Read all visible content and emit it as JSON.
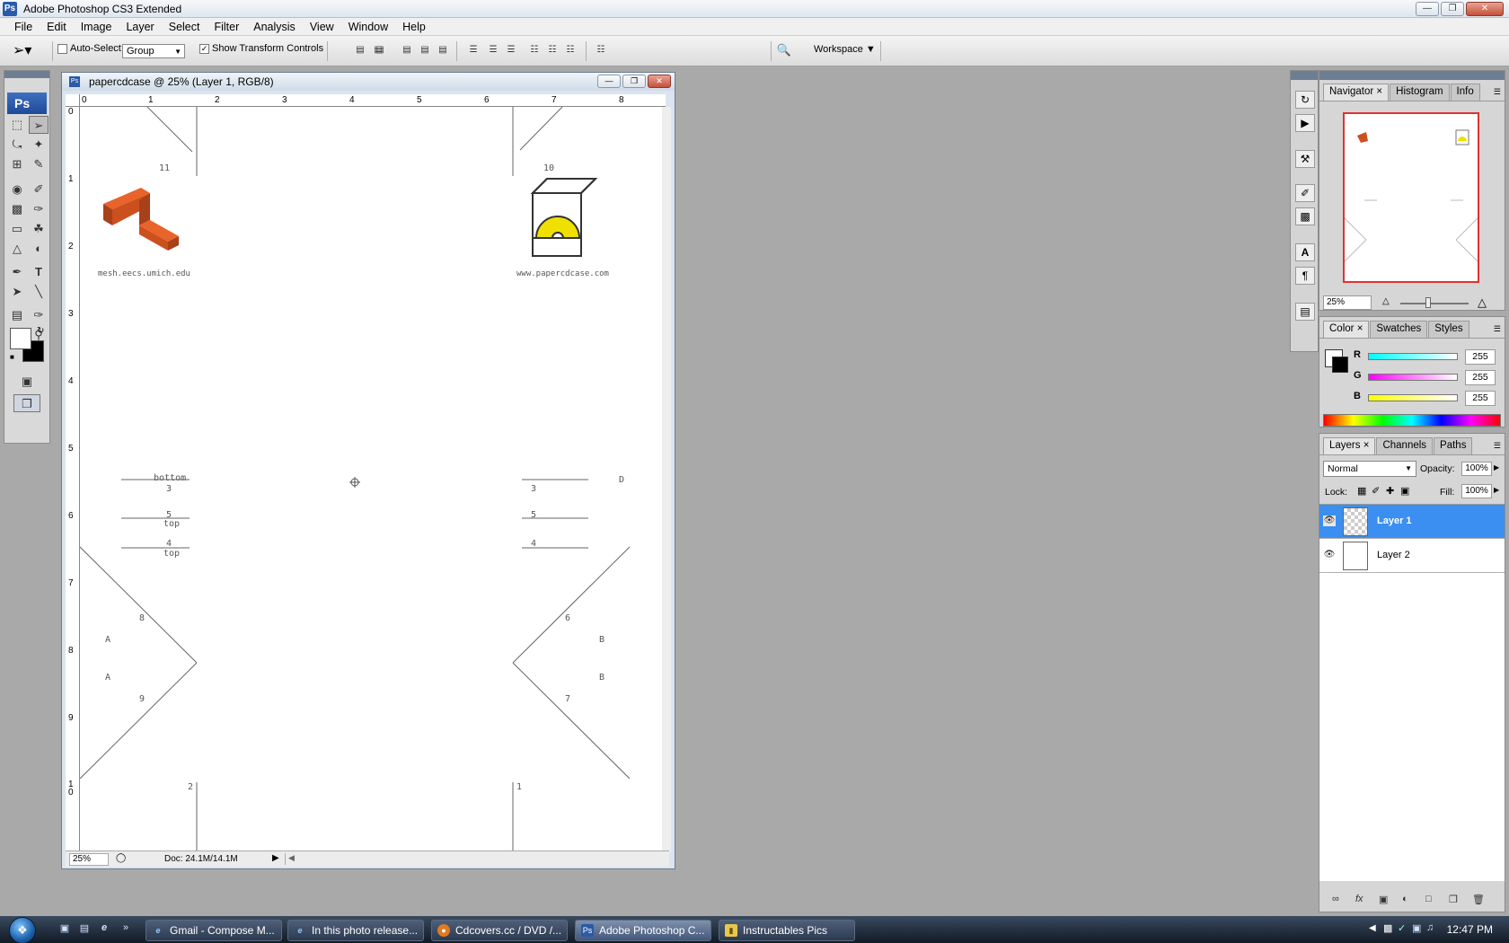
{
  "app": {
    "title": "Adobe Photoshop CS3 Extended",
    "icon": "Ps",
    "window_controls": [
      "minimize",
      "maximize",
      "close"
    ]
  },
  "menu": [
    "File",
    "Edit",
    "Image",
    "Layer",
    "Select",
    "Filter",
    "Analysis",
    "View",
    "Window",
    "Help"
  ],
  "options": {
    "auto_select_label": "Auto-Select:",
    "auto_select_value": "Group",
    "auto_select_checked": false,
    "show_transform_label": "Show Transform Controls",
    "show_transform_checked": true,
    "workspace_label": "Workspace"
  },
  "toolbox": {
    "logo": "Ps",
    "tools": [
      "move",
      "marquee",
      "lasso",
      "magic-wand",
      "crop",
      "slice",
      "healing",
      "brush",
      "stamp",
      "history-brush",
      "eraser",
      "paint-bucket",
      "blur",
      "dodge",
      "pen",
      "type",
      "path-selection",
      "line",
      "notes",
      "eyedropper",
      "hand",
      "zoom"
    ],
    "foreground": "#ffffff",
    "background": "#000000"
  },
  "document": {
    "title": "papercdcase @ 25% (Layer 1, RGB/8)",
    "zoom": "25%",
    "doc_info": "Doc: 24.1M/14.1M",
    "ruler_h": [
      "0",
      "1",
      "2",
      "3",
      "4",
      "5",
      "6",
      "7",
      "8"
    ],
    "ruler_v": [
      "0",
      "1",
      "2",
      "3",
      "4",
      "5",
      "6",
      "7",
      "8",
      "9",
      "1\n0"
    ],
    "canvas": {
      "left_url": "mesh.eecs.umich.edu",
      "right_url": "www.papercdcase.com",
      "num_11": "11",
      "num_10": "10",
      "bottom_label": "bottom",
      "top_label_1": "top",
      "top_label_2": "top",
      "left_nums": [
        "3",
        "5",
        "4"
      ],
      "right_nums": [
        "3",
        "5",
        "4"
      ],
      "num_8": "8",
      "num_9": "9",
      "num_6": "6",
      "num_7": "7",
      "letter_a1": "A",
      "letter_a2": "A",
      "letter_b1": "B",
      "letter_b2": "B",
      "num_2": "2",
      "num_1": "1",
      "letter_d": "D"
    }
  },
  "navigator_panel": {
    "tabs": [
      "Navigator",
      "Histogram",
      "Info"
    ],
    "zoom": "25%"
  },
  "color_panel": {
    "tabs": [
      "Color",
      "Swatches",
      "Styles"
    ],
    "channels": [
      {
        "label": "R",
        "value": "255",
        "color": "#00e0e0"
      },
      {
        "label": "G",
        "value": "255",
        "color": "#e000e0"
      },
      {
        "label": "B",
        "value": "255",
        "color": "#e0e000"
      }
    ]
  },
  "layers_panel": {
    "tabs": [
      "Layers",
      "Channels",
      "Paths"
    ],
    "blend_mode": "Normal",
    "opacity_label": "Opacity:",
    "opacity": "100%",
    "lock_label": "Lock:",
    "fill_label": "Fill:",
    "fill": "100%",
    "layers": [
      {
        "name": "Layer 1",
        "selected": true
      },
      {
        "name": "Layer 2",
        "selected": false
      }
    ]
  },
  "taskbar": {
    "start": "start",
    "tasks": [
      {
        "label": "Gmail - Compose M...",
        "icon": "ie-icon"
      },
      {
        "label": "In this photo release...",
        "icon": "ie-icon"
      },
      {
        "label": "Cdcovers.cc / DVD /...",
        "icon": "firefox-icon"
      },
      {
        "label": "Adobe Photoshop C...",
        "icon": "photoshop-icon",
        "active": true
      },
      {
        "label": "Instructables Pics",
        "icon": "folder-icon"
      }
    ],
    "clock": "12:47 PM"
  }
}
